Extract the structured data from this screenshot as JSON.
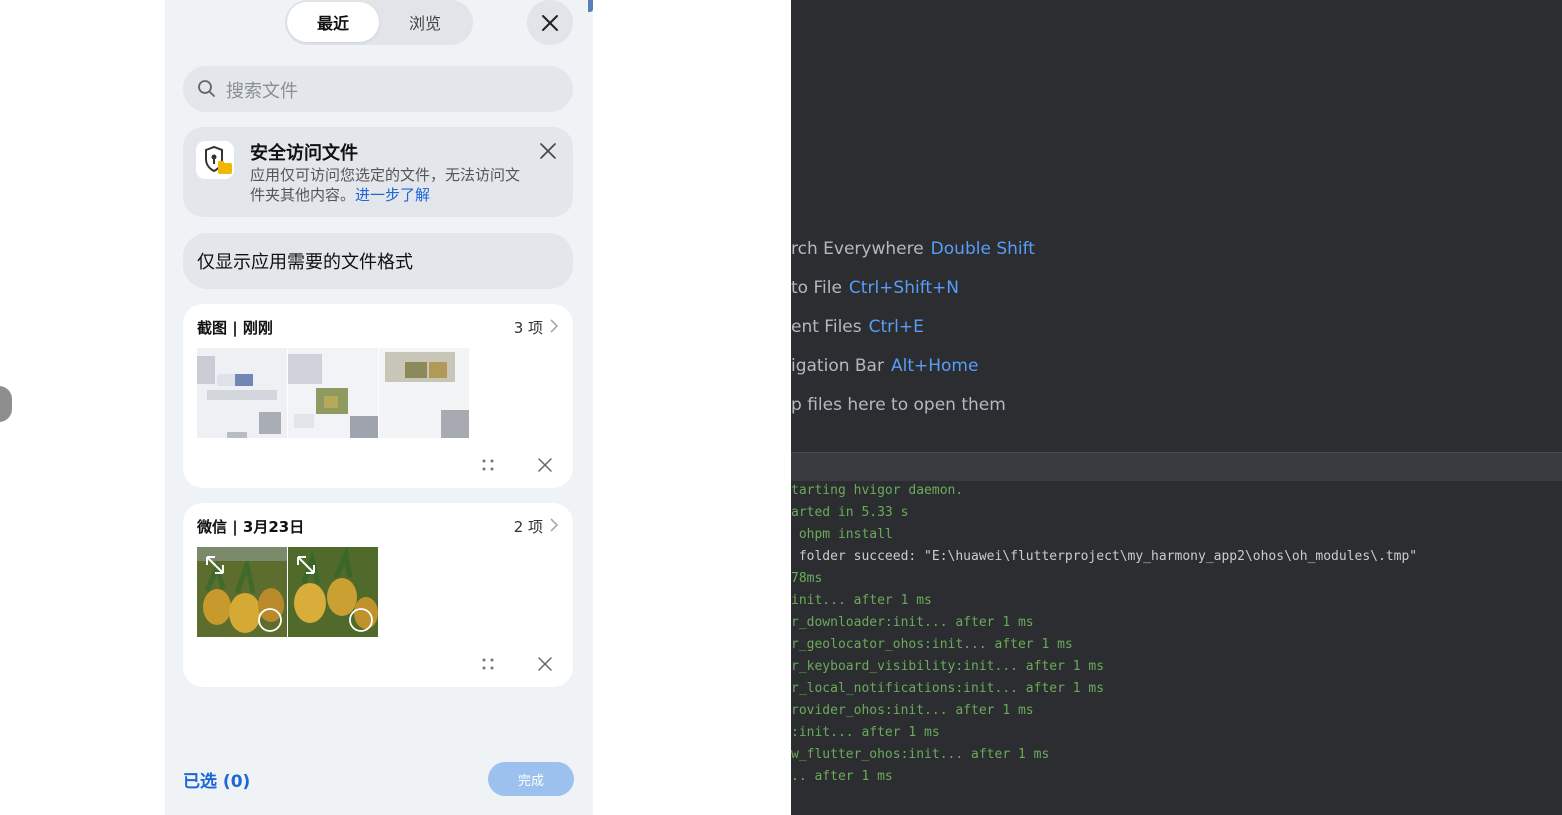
{
  "picker": {
    "tabs": [
      {
        "label": "最近",
        "active": true
      },
      {
        "label": "浏览",
        "active": false
      }
    ],
    "search_placeholder": "搜索文件",
    "notice": {
      "title": "安全访问文件",
      "desc": "应用仅可访问您选定的文件，无法访问文件夹其他内容。",
      "link": "进一步了解"
    },
    "filter_label": "仅显示应用需要的文件格式",
    "groups": [
      {
        "title": "截图 | 刚刚",
        "count": "3 项"
      },
      {
        "title": "微信 | 3月23日",
        "count": "2 项"
      }
    ],
    "selected": "已选 (0)",
    "done": "完成"
  },
  "ide": {
    "tips": [
      {
        "label": "rch Everywhere",
        "key": "Double Shift"
      },
      {
        "label": "to File",
        "key": "Ctrl+Shift+N"
      },
      {
        "label": "ent Files",
        "key": "Ctrl+E"
      },
      {
        "label": "igation Bar",
        "key": "Alt+Home"
      },
      {
        "label": "p files here to open them",
        "key": ""
      }
    ],
    "log_lines": [
      "tarting hvigor daemon.",
      "arted in 5.33 s",
      " ohpm install",
      " folder succeed: \"E:\\huawei\\flutterproject\\my_harmony_app2\\ohos\\oh_modules\\.tmp\"",
      "78ms",
      "init... after 1 ms",
      "r_downloader:init... after 1 ms",
      "r_geolocator_ohos:init... after 1 ms",
      "r_keyboard_visibility:init... after 1 ms",
      "r_local_notifications:init... after 1 ms",
      "rovider_ohos:init... after 1 ms",
      ":init... after 1 ms",
      "w_flutter_ohos:init... after 1 ms",
      ".. after 1 ms"
    ]
  },
  "colors": {
    "accent": "#1c66d6",
    "panel_bg": "#f0f3f6",
    "ide_bg": "#2b2d30",
    "log_green": "#6aab5a",
    "shortcut_blue": "#589df6"
  }
}
